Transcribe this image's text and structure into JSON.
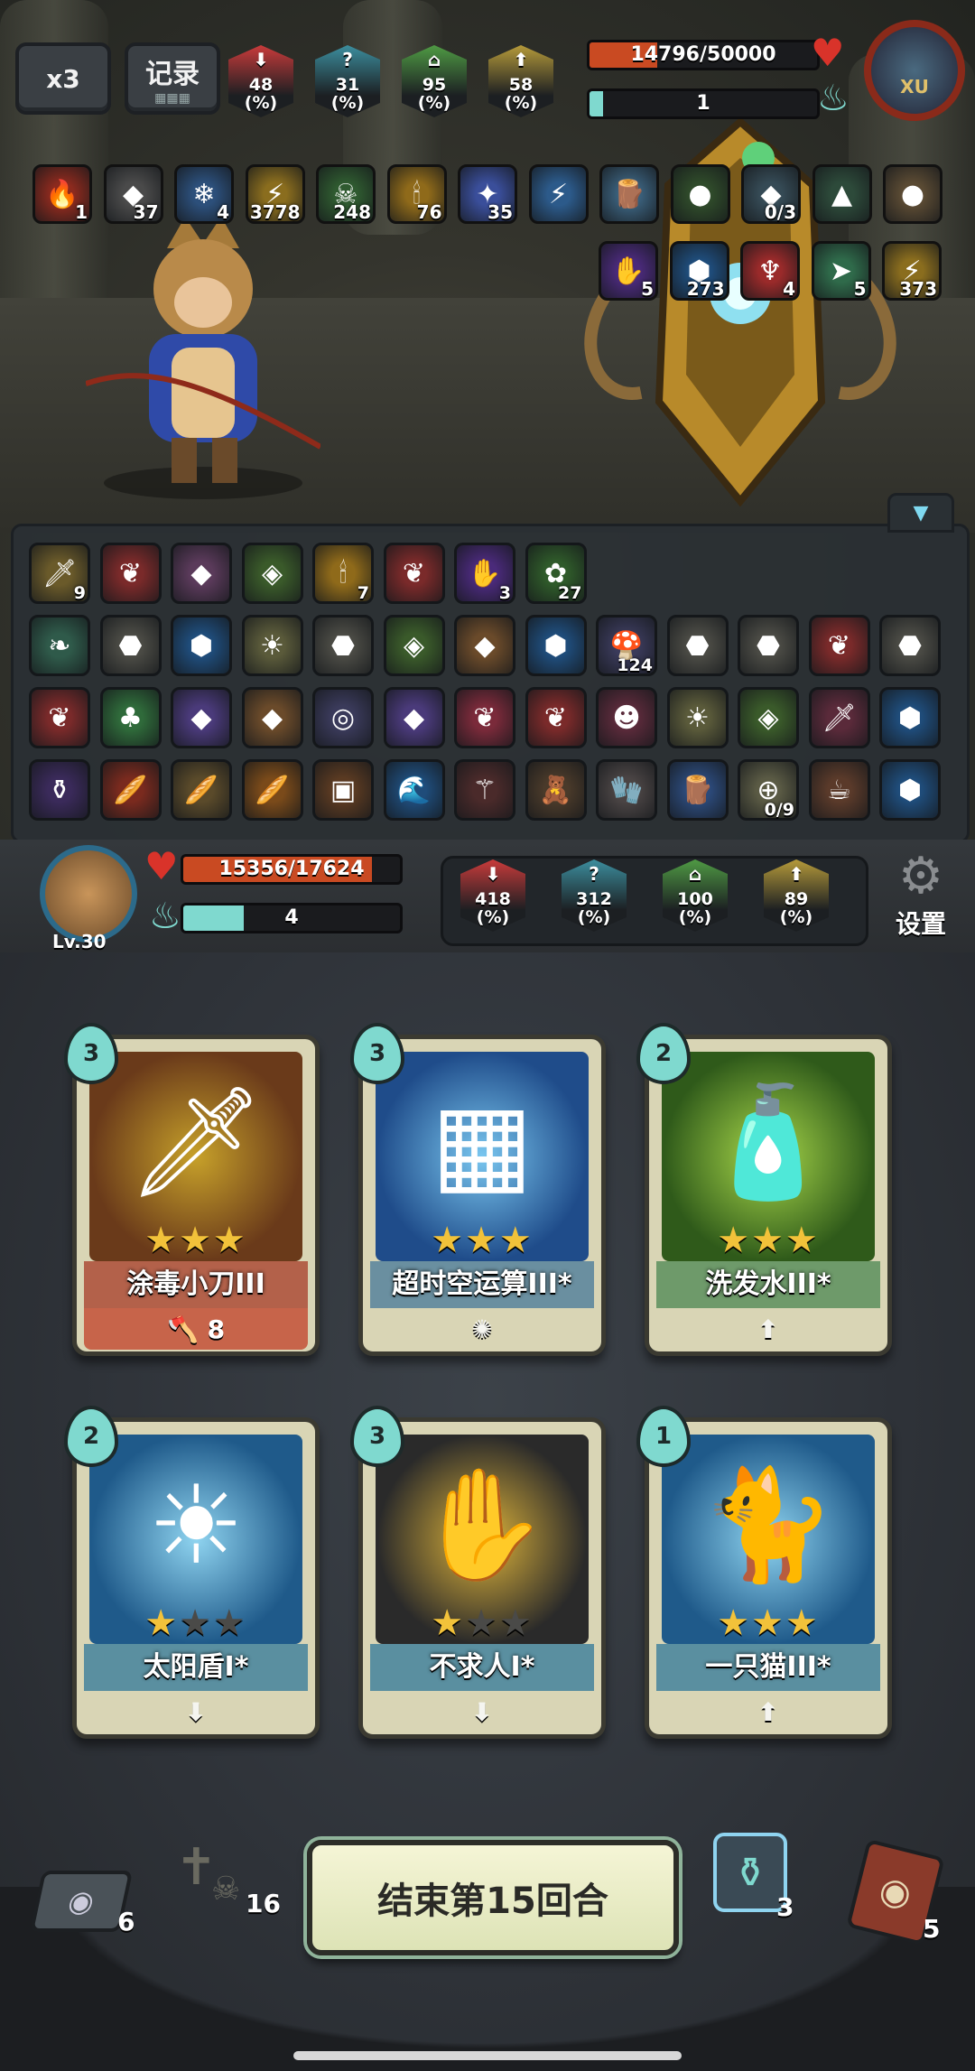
{
  "top_bar": {
    "speed_label": "x3",
    "record_label": "记录"
  },
  "enemy": {
    "stats": [
      {
        "value": "48",
        "unit": "(%)",
        "color": "#c93b3b",
        "icon": "attack-down-icon"
      },
      {
        "value": "31",
        "unit": "(%)",
        "color": "#3c8e9e",
        "icon": "question-icon"
      },
      {
        "value": "95",
        "unit": "(%)",
        "color": "#4f9a44",
        "icon": "defense-icon"
      },
      {
        "value": "58",
        "unit": "(%)",
        "color": "#b59a3a",
        "icon": "speed-up-icon"
      }
    ],
    "hp_text": "14796/50000",
    "hp_fraction": 0.296,
    "energy_text": "1",
    "energy_fraction": 0.06,
    "avatar_label": "XU"
  },
  "enemy_buffs_row1": [
    {
      "glyph": "🔥",
      "count": "1",
      "bg": "#8c2a1e",
      "icon": "blood-flame-icon"
    },
    {
      "glyph": "◆",
      "count": "37",
      "bg": "#4a4a4a",
      "icon": "stone-armor-icon"
    },
    {
      "glyph": "❄",
      "count": "4",
      "bg": "#2c4f7a",
      "icon": "snowflake-icon"
    },
    {
      "glyph": "⚡",
      "count": "3778",
      "bg": "#8a6d1e",
      "icon": "lightning-icon"
    },
    {
      "glyph": "☠",
      "count": "248",
      "bg": "#2f5a30",
      "icon": "poison-skull-icon"
    },
    {
      "glyph": "🕯",
      "count": "76",
      "bg": "#8f6a1a",
      "icon": "candle-icon"
    },
    {
      "glyph": "✦",
      "count": "35",
      "bg": "#3a4e9a",
      "icon": "star-burst-icon"
    },
    {
      "glyph": "⚡",
      "count": "",
      "bg": "#2c5a8a",
      "icon": "shock-figure-icon"
    },
    {
      "glyph": "🪵",
      "count": "",
      "bg": "#3a5f7a",
      "icon": "staff-icon"
    },
    {
      "glyph": "●",
      "count": "",
      "bg": "#2f4a2a",
      "icon": "green-orb-icon"
    },
    {
      "glyph": "◆",
      "count": "0/3",
      "bg": "#354a55",
      "icon": "cube-icon"
    },
    {
      "glyph": "▲",
      "count": "",
      "bg": "#2d4a3a",
      "icon": "pyramid-icon"
    },
    {
      "glyph": "●",
      "count": "",
      "bg": "#5a4a33",
      "icon": "rock-ball-icon"
    }
  ],
  "enemy_buffs_row2": [
    {
      "glyph": "✋",
      "count": "5",
      "bg": "#4a2a7a",
      "icon": "dark-hand-icon"
    },
    {
      "glyph": "⬢",
      "count": "273",
      "bg": "#1f4c7a",
      "icon": "shield-icon"
    },
    {
      "glyph": "♆",
      "count": "4",
      "bg": "#9a2a2a",
      "icon": "rage-icon"
    },
    {
      "glyph": "➤",
      "count": "5",
      "bg": "#2f6a4a",
      "icon": "dash-icon"
    },
    {
      "glyph": "⚡",
      "count": "373",
      "bg": "#8a6d1e",
      "icon": "bolt-icon"
    }
  ],
  "inventory_rows": [
    [
      {
        "glyph": "🗡",
        "count": "9",
        "bg": "#6a5a2a",
        "icon": "sword-icon"
      },
      {
        "glyph": "❦",
        "count": "",
        "bg": "#7a2a2a",
        "icon": "red-gem-icon"
      },
      {
        "glyph": "◆",
        "count": "",
        "bg": "#5a3a5a",
        "icon": "crystal-icon"
      },
      {
        "glyph": "◈",
        "count": "",
        "bg": "#3a5a2a",
        "icon": "green-stone-icon"
      },
      {
        "glyph": "🕯",
        "count": "7",
        "bg": "#8f6a1a",
        "icon": "candle-icon"
      },
      {
        "glyph": "❦",
        "count": "",
        "bg": "#7a2a2a",
        "icon": "red-gem-icon"
      },
      {
        "glyph": "✋",
        "count": "3",
        "bg": "#4a2a7a",
        "icon": "dark-hand-icon"
      },
      {
        "glyph": "✿",
        "count": "27",
        "bg": "#2f5a2a",
        "icon": "plant-icon"
      }
    ],
    [
      {
        "glyph": "❧",
        "count": "",
        "bg": "#2f5a4a",
        "icon": "feather-icon"
      },
      {
        "glyph": "⬣",
        "count": "",
        "bg": "#4a4a44",
        "icon": "iron-ore-icon"
      },
      {
        "glyph": "⬢",
        "count": "",
        "bg": "#1f4c7a",
        "icon": "blue-gem-icon"
      },
      {
        "glyph": "☀",
        "count": "",
        "bg": "#5a5a3a",
        "icon": "sun-coin-icon"
      },
      {
        "glyph": "⬣",
        "count": "",
        "bg": "#4a4a44",
        "icon": "iron-ore-icon"
      },
      {
        "glyph": "◈",
        "count": "",
        "bg": "#3a5a2a",
        "icon": "green-stone-icon"
      },
      {
        "glyph": "◆",
        "count": "",
        "bg": "#6a4a2a",
        "icon": "amber-icon"
      },
      {
        "glyph": "⬢",
        "count": "",
        "bg": "#1f4c7a",
        "icon": "blue-gem-icon"
      },
      {
        "glyph": "🍄",
        "count": "124",
        "bg": "#3a3a5a",
        "icon": "mushroom-icon"
      },
      {
        "glyph": "⬣",
        "count": "",
        "bg": "#4a4a44",
        "icon": "iron-ore-icon"
      },
      {
        "glyph": "⬣",
        "count": "",
        "bg": "#4a4a44",
        "icon": "iron-ore-icon"
      },
      {
        "glyph": "❦",
        "count": "",
        "bg": "#7a2a2a",
        "icon": "red-gem-icon"
      },
      {
        "glyph": "⬣",
        "count": "",
        "bg": "#4a4a44",
        "icon": "iron-ore-icon"
      }
    ],
    [
      {
        "glyph": "❦",
        "count": "",
        "bg": "#7a2a2a",
        "icon": "red-gem-icon"
      },
      {
        "glyph": "♣",
        "count": "",
        "bg": "#2f6a3a",
        "icon": "green-potion-icon"
      },
      {
        "glyph": "◆",
        "count": "",
        "bg": "#4a3a7a",
        "icon": "purple-crystal-icon"
      },
      {
        "glyph": "◆",
        "count": "",
        "bg": "#6a4a2a",
        "icon": "amber-icon"
      },
      {
        "glyph": "◎",
        "count": "",
        "bg": "#3a3a5a",
        "icon": "dark-disc-icon"
      },
      {
        "glyph": "◆",
        "count": "",
        "bg": "#4a3a7a",
        "icon": "purple-crystal-icon"
      },
      {
        "glyph": "❦",
        "count": "",
        "bg": "#7a2a3a",
        "icon": "red-heart-icon"
      },
      {
        "glyph": "❦",
        "count": "",
        "bg": "#7a2a2a",
        "icon": "red-gem-icon"
      },
      {
        "glyph": "☻",
        "count": "",
        "bg": "#5a2a3a",
        "icon": "creature-icon"
      },
      {
        "glyph": "☀",
        "count": "",
        "bg": "#5a5a3a",
        "icon": "sun-coin-icon"
      },
      {
        "glyph": "◈",
        "count": "",
        "bg": "#3a5a2a",
        "icon": "green-stone-icon"
      },
      {
        "glyph": "🗡",
        "count": "",
        "bg": "#5a2a3a",
        "icon": "dagger-icon"
      },
      {
        "glyph": "⬢",
        "count": "",
        "bg": "#1f4c7a",
        "icon": "blue-gem-icon"
      }
    ],
    [
      {
        "glyph": "⚱",
        "count": "",
        "bg": "#3a2a5a",
        "icon": "gourd-icon"
      },
      {
        "glyph": "🥖",
        "count": "",
        "bg": "#7a2a1e",
        "icon": "red-tube-icon"
      },
      {
        "glyph": "🥖",
        "count": "",
        "bg": "#5a4a2a",
        "icon": "bread-icon"
      },
      {
        "glyph": "🥖",
        "count": "",
        "bg": "#7a4a1a",
        "icon": "baguette-icon"
      },
      {
        "glyph": "▣",
        "count": "",
        "bg": "#5a3a22",
        "icon": "crate-icon"
      },
      {
        "glyph": "🌊",
        "count": "",
        "bg": "#1f4c7a",
        "icon": "water-drop-icon"
      },
      {
        "glyph": "⚚",
        "count": "",
        "bg": "#4a2a2a",
        "icon": "staff-icon"
      },
      {
        "glyph": "🧸",
        "count": "",
        "bg": "#4a3a2a",
        "icon": "teddy-bear-icon"
      },
      {
        "glyph": "🧤",
        "count": "",
        "bg": "#4a4444",
        "icon": "glove-icon"
      },
      {
        "glyph": "🪵",
        "count": "",
        "bg": "#2c4a7a",
        "icon": "wand-icon"
      },
      {
        "glyph": "⊕",
        "count": "0/9",
        "bg": "#5a5a44",
        "icon": "compass-icon"
      },
      {
        "glyph": "☕",
        "count": "",
        "bg": "#5a3a2a",
        "icon": "teacup-icon"
      },
      {
        "glyph": "⬢",
        "count": "",
        "bg": "#1f4c7a",
        "icon": "blue-gem-icon"
      }
    ]
  ],
  "player": {
    "level": "Lv.30",
    "hp_text": "15356/17624",
    "hp_fraction": 0.871,
    "energy_text": "4",
    "energy_fraction": 0.28,
    "stats": [
      {
        "value": "418",
        "unit": "(%)",
        "color": "#c93b3b",
        "icon": "attack-down-icon"
      },
      {
        "value": "312",
        "unit": "(%)",
        "color": "#3c8e9e",
        "icon": "question-icon"
      },
      {
        "value": "100",
        "unit": "(%)",
        "color": "#4f9a44",
        "icon": "defense-icon"
      },
      {
        "value": "89",
        "unit": "(%)",
        "color": "#b59a3a",
        "icon": "speed-up-icon"
      }
    ],
    "settings_label": "设置"
  },
  "hand": [
    {
      "cost": "3",
      "name": "涂毒小刀III",
      "stars": 3,
      "max_stars": 3,
      "art": "🗡",
      "art_bg": "#6a3a1a",
      "art_bg2": "#c7a12a",
      "foot": "🪓 8",
      "name_bg": "#b3614a",
      "foot_bg": "#c7644a",
      "icon": "poison-dagger-icon"
    },
    {
      "cost": "3",
      "name": "超时空运算III*",
      "stars": 3,
      "max_stars": 3,
      "art": "▦",
      "art_bg": "#1f4c8a",
      "art_bg2": "#7ac7f0",
      "foot": "✺",
      "name_bg": "#6a8fa0",
      "foot_bg": "#d9d5b5",
      "icon": "circuit-card-icon"
    },
    {
      "cost": "2",
      "name": "洗发水III*",
      "stars": 3,
      "max_stars": 3,
      "art": "🧴",
      "art_bg": "#2f5a1a",
      "art_bg2": "#a9d94a",
      "foot": "⬆",
      "name_bg": "#6e9a6a",
      "foot_bg": "#d9d5b5",
      "icon": "shampoo-icon"
    },
    {
      "cost": "2",
      "name": "太阳盾I*",
      "stars": 1,
      "max_stars": 3,
      "art": "☀",
      "art_bg": "#1f5a8a",
      "art_bg2": "#8fd4f0",
      "foot": "⬇",
      "name_bg": "#5a8fa0",
      "foot_bg": "#d9d5b5",
      "icon": "sun-shield-icon"
    },
    {
      "cost": "3",
      "name": "不求人I*",
      "stars": 1,
      "max_stars": 3,
      "art": "✋",
      "art_bg": "#2a2a2a",
      "art_bg2": "#e0b53a",
      "foot": "⬇",
      "name_bg": "#5a8fa0",
      "foot_bg": "#d9d5b5",
      "icon": "back-scratcher-icon"
    },
    {
      "cost": "1",
      "name": "一只猫III*",
      "stars": 3,
      "max_stars": 3,
      "art": "🐈",
      "art_bg": "#1f5a8a",
      "art_bg2": "#8fd4f0",
      "foot": "⬆",
      "name_bg": "#5a8fa0",
      "foot_bg": "#d9d5b5",
      "icon": "white-cat-icon"
    }
  ],
  "bottom": {
    "draw_pile_count": "6",
    "grave_count": "16",
    "end_turn_label": "结束第15回合",
    "potion_count": "3",
    "discard_count": "5"
  }
}
